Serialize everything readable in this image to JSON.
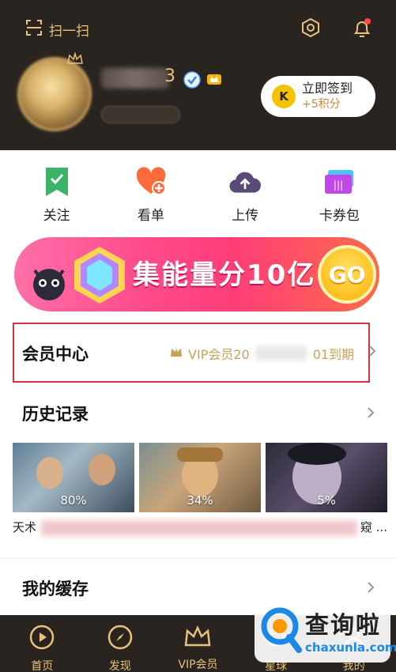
{
  "header": {
    "scan_label": "扫一扫",
    "username_visible_tail": "3",
    "checkin": {
      "coin_letter": "K",
      "title": "立即签到",
      "reward": "+5积分"
    }
  },
  "quick_actions": [
    {
      "label": "关注",
      "icon": "bookmark-check-icon"
    },
    {
      "label": "看单",
      "icon": "heart-plus-icon"
    },
    {
      "label": "上传",
      "icon": "cloud-upload-icon"
    },
    {
      "label": "卡券包",
      "icon": "ticket-icon"
    }
  ],
  "banner": {
    "text": "集能量分10亿",
    "button": "GO"
  },
  "member_center": {
    "title": "会员中心",
    "vip_prefix": "VIP会员20",
    "vip_suffix": "01到期"
  },
  "history": {
    "title": "历史记录",
    "items": [
      {
        "progress": "80%"
      },
      {
        "progress": "34%"
      },
      {
        "progress": "5%"
      }
    ],
    "line_left": "天术",
    "line_right": "窥 ..."
  },
  "cache": {
    "title": "我的缓存"
  },
  "bottom_nav": [
    {
      "label": "首页",
      "icon": "play-circle-icon"
    },
    {
      "label": "发现",
      "icon": "compass-icon"
    },
    {
      "label": "VIP会员",
      "icon": "crown-icon"
    },
    {
      "label": "星球",
      "icon": "planet-icon"
    },
    {
      "label": "我的",
      "icon": "user-icon"
    }
  ],
  "watermark": {
    "title": "查询啦",
    "url": "chaxunla.com"
  },
  "colors": {
    "header_bg": "#2a2421",
    "gold": "#e8c27a",
    "highlight_red": "#d8333a",
    "banner_pink": "#ff4b8c"
  }
}
